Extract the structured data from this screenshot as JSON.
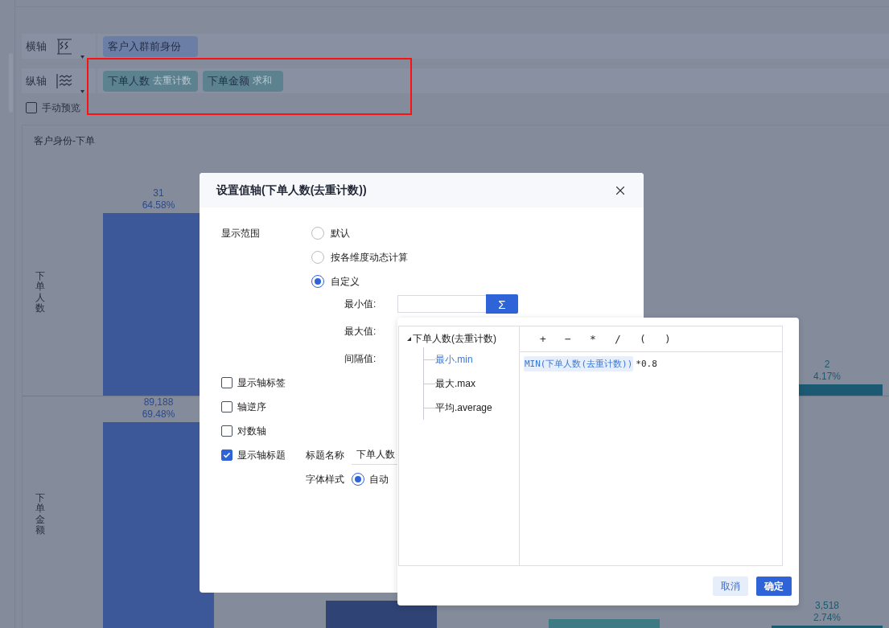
{
  "axes": [
    {
      "label": "横轴",
      "kind": "horizontal",
      "pills": [
        {
          "name": "客户入群前身份",
          "kind": "dimension"
        }
      ]
    },
    {
      "label": "纵轴",
      "kind": "vertical",
      "pills": [
        {
          "name": "下单人数",
          "aggregation": "去重计数",
          "kind": "measure"
        },
        {
          "name": "下单金额",
          "aggregation": "求和",
          "kind": "measure"
        }
      ]
    }
  ],
  "manual_preview": {
    "label": "手动预览",
    "checked": false
  },
  "highlight_frame": true,
  "chart": {
    "title": "客户身份-下单",
    "panels": [
      {
        "axis_title": "下单人数",
        "bar_labels": [
          {
            "value": "31",
            "percent": "64.58%"
          },
          {
            "value": "2",
            "percent": "4.17%"
          }
        ]
      },
      {
        "axis_title": "下单金额",
        "bar_labels": [
          {
            "value": "89,188",
            "percent": "69.48%"
          },
          {
            "value": "3,518",
            "percent": "2.74%"
          }
        ]
      }
    ]
  },
  "dialog": {
    "title": "设置值轴(下单人数(去重计数))",
    "range": {
      "label": "显示范围",
      "options": [
        {
          "label": "默认",
          "selected": false
        },
        {
          "label": "按各维度动态计算",
          "selected": false
        },
        {
          "label": "自定义",
          "selected": true
        }
      ],
      "custom_fields": [
        {
          "label": "最小值:",
          "button": "Σ"
        },
        {
          "label": "最大值:"
        },
        {
          "label": "间隔值:"
        }
      ]
    },
    "options": [
      {
        "label": "显示轴标签",
        "checked": false
      },
      {
        "label": "轴逆序",
        "checked": false
      },
      {
        "label": "对数轴",
        "checked": false
      },
      {
        "label": "显示轴标题",
        "checked": true
      }
    ],
    "axis_title": {
      "name_label": "标题名称",
      "name_value": "下单人数",
      "font_label": "字体样式",
      "font_options": [
        {
          "label": "自动",
          "selected": true
        }
      ]
    }
  },
  "formula_popup": {
    "tree": {
      "label": "下单人数(去重计数)",
      "expanded": true,
      "children": [
        {
          "label": "最小.min",
          "selected": true
        },
        {
          "label": "最大.max",
          "selected": false
        },
        {
          "label": "平均.average",
          "selected": false
        }
      ]
    },
    "operators": [
      "+",
      "−",
      "*",
      "/",
      "(",
      ")"
    ],
    "formula": [
      {
        "kind": "field",
        "text": "MIN(下单人数(去重计数))"
      },
      {
        "kind": "text",
        "text": "*0.8"
      }
    ],
    "buttons": [
      {
        "label": "取消",
        "kind": "secondary"
      },
      {
        "label": "确定",
        "kind": "primary"
      }
    ]
  }
}
